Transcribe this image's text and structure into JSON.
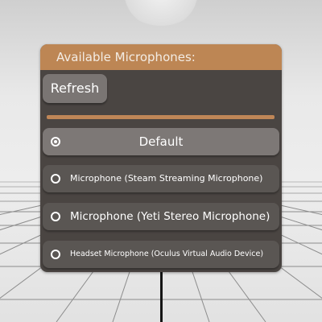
{
  "panel": {
    "title": "Available Microphones:",
    "refresh_label": "Refresh",
    "accent_color": "#bd8654",
    "background_color": "#4a4542"
  },
  "microphones": [
    {
      "label": "Default",
      "selected": true
    },
    {
      "label": "Microphone (Steam Streaming Microphone)",
      "selected": false
    },
    {
      "label": "Microphone (Yeti Stereo Microphone)",
      "selected": false
    },
    {
      "label": "Headset Microphone (Oculus Virtual Audio Device)",
      "selected": false
    }
  ]
}
